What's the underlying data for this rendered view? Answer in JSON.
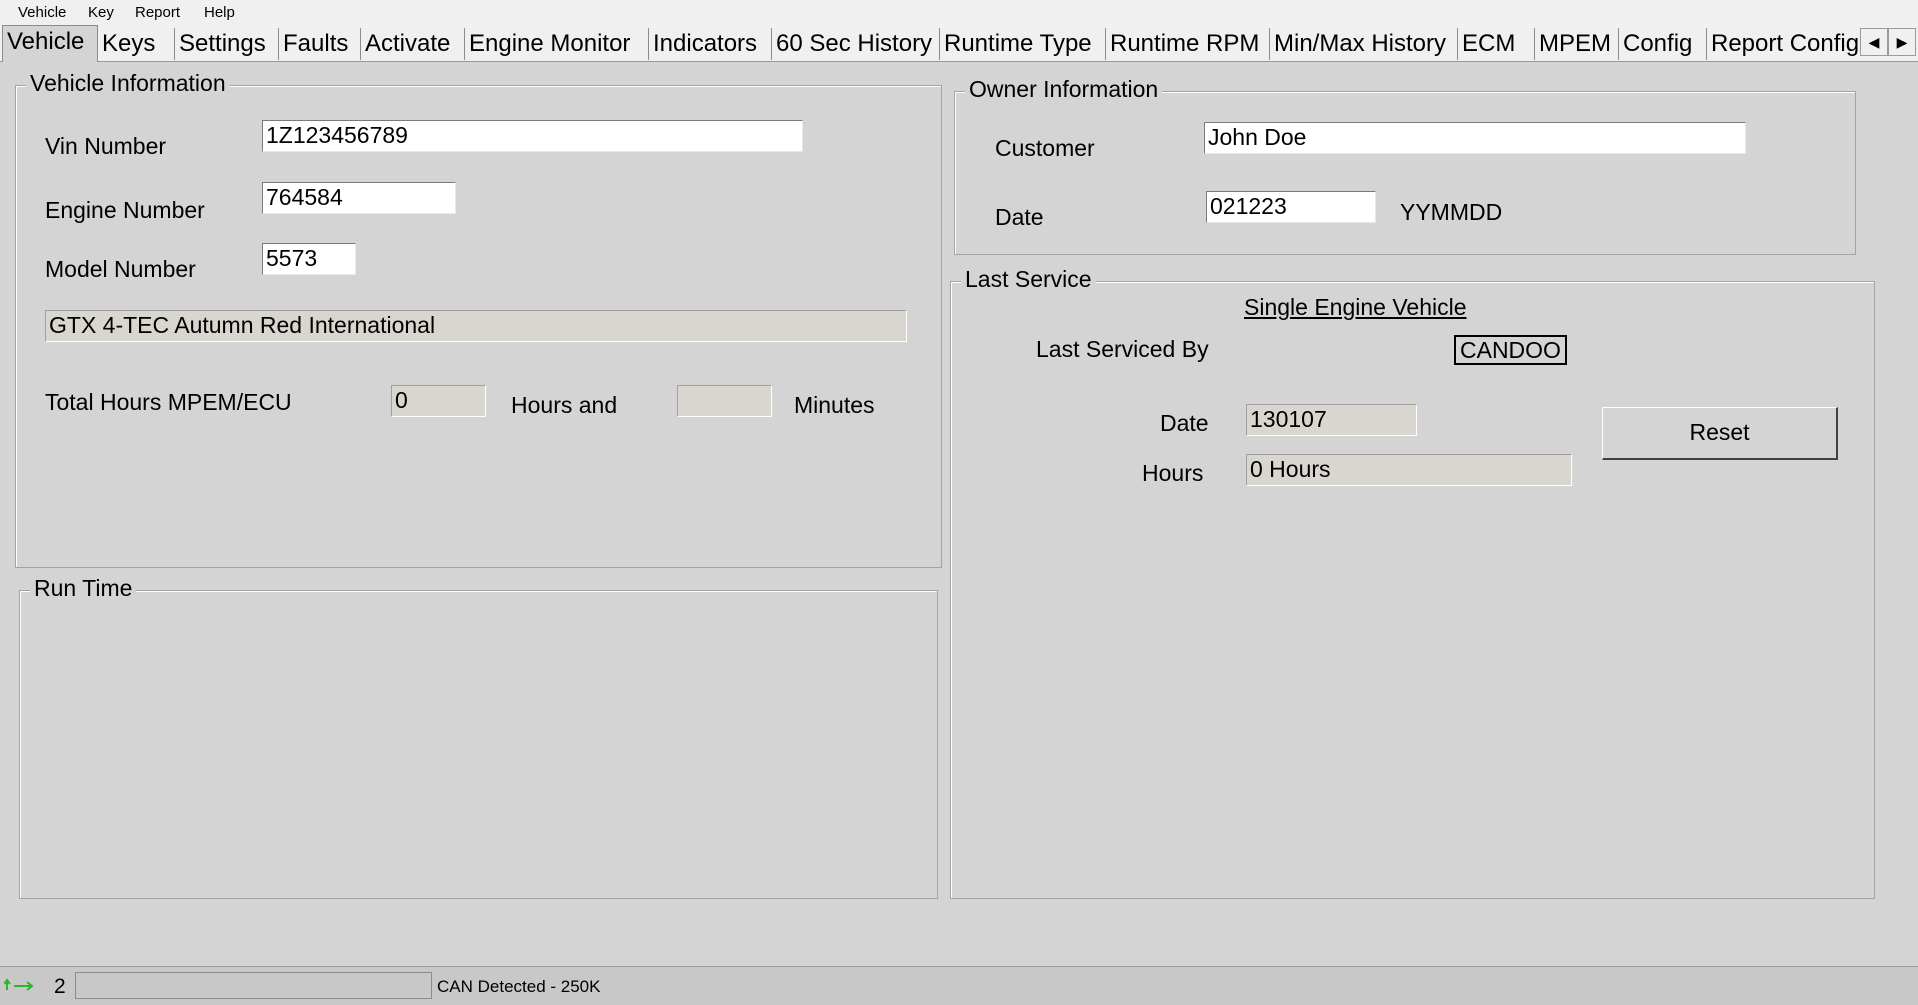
{
  "menu": {
    "items": [
      {
        "label": "Vehicle"
      },
      {
        "label": "Key"
      },
      {
        "label": "Report"
      },
      {
        "label": "Help"
      }
    ]
  },
  "tabs": [
    {
      "label": "Vehicle"
    },
    {
      "label": "Keys"
    },
    {
      "label": "Settings"
    },
    {
      "label": "Faults"
    },
    {
      "label": "Activate"
    },
    {
      "label": "Engine Monitor"
    },
    {
      "label": "Indicators"
    },
    {
      "label": "60 Sec History"
    },
    {
      "label": "Runtime Type"
    },
    {
      "label": "Runtime RPM"
    },
    {
      "label": "Min/Max History"
    },
    {
      "label": "ECM"
    },
    {
      "label": "MPEM"
    },
    {
      "label": "Config"
    },
    {
      "label": "Report Config"
    }
  ],
  "tab_scroll": {
    "left": "◀",
    "right": "▶"
  },
  "vehicle_info": {
    "title": "Vehicle Information",
    "vin_label": "Vin Number",
    "vin_value": "1Z123456789",
    "engine_label": "Engine Number",
    "engine_value": "764584",
    "model_label": "Model Number",
    "model_value": "5573",
    "description": "GTX 4-TEC Autumn Red International",
    "total_hours_label": "Total Hours MPEM/ECU",
    "hours_value": "0",
    "hours_and_label": "Hours and",
    "minutes_value": "",
    "minutes_label": "Minutes"
  },
  "run_time": {
    "title": "Run Time"
  },
  "owner_info": {
    "title": "Owner Information",
    "customer_label": "Customer",
    "customer_value": "John Doe",
    "date_label": "Date",
    "date_value": "021223",
    "date_format": "YYMMDD"
  },
  "last_service": {
    "title": "Last Service",
    "vehicle_type": "Single Engine Vehicle",
    "serviced_by_label": "Last Serviced By",
    "serviced_by_value": "CANDOO",
    "date_label": "Date",
    "date_value": "130107",
    "hours_label": "Hours",
    "hours_value": "0 Hours",
    "reset_label": "Reset"
  },
  "status": {
    "indicator_icon": "connection-arrows-icon",
    "count": "2",
    "progress_text": "",
    "message": "CAN Detected - 250K"
  }
}
